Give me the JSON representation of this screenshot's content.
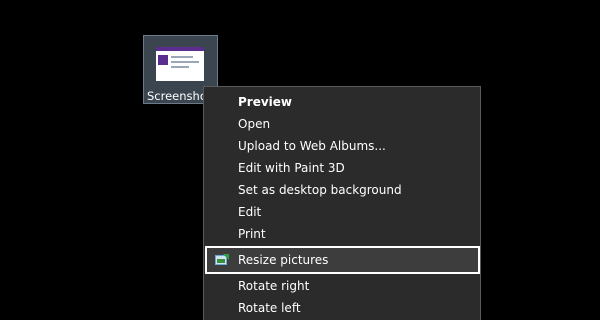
{
  "desktop": {
    "file": {
      "label": "Screenshot"
    }
  },
  "context_menu": {
    "items": [
      {
        "label": "Preview"
      },
      {
        "label": "Open"
      },
      {
        "label": "Upload to Web Albums..."
      },
      {
        "label": "Edit with Paint 3D"
      },
      {
        "label": "Set as desktop background"
      },
      {
        "label": "Edit"
      },
      {
        "label": "Print"
      },
      {
        "label": "Resize pictures",
        "icon": "resize-pictures-icon"
      },
      {
        "label": "Rotate right"
      },
      {
        "label": "Rotate left"
      }
    ]
  },
  "colors": {
    "background": "#000000",
    "menu_background": "#2b2b2b",
    "highlight_border": "#ffffff"
  }
}
